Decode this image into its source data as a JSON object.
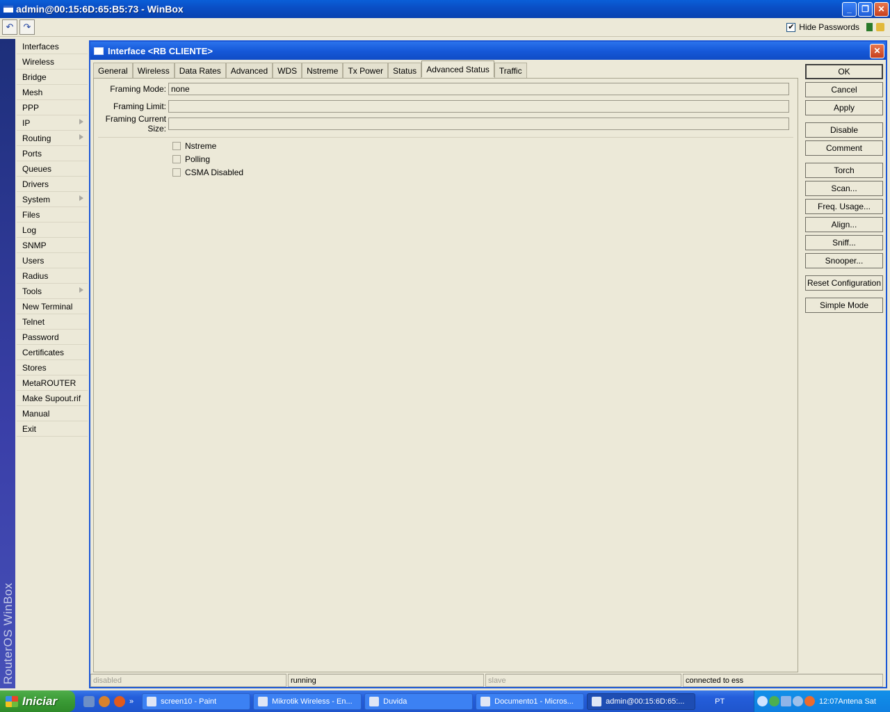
{
  "window": {
    "title": "admin@00:15:6D:65:B5:73 - WinBox"
  },
  "toolbar": {
    "undo_label": "↶",
    "redo_label": "↷",
    "hide_passwords_label": "Hide Passwords",
    "hide_passwords_checked": true,
    "check_mark": "✔"
  },
  "vband": {
    "label": "RouterOS WinBox"
  },
  "sidebar": {
    "items": [
      {
        "label": "Interfaces"
      },
      {
        "label": "Wireless"
      },
      {
        "label": "Bridge"
      },
      {
        "label": "Mesh"
      },
      {
        "label": "PPP"
      },
      {
        "label": "IP",
        "submenu": true
      },
      {
        "label": "Routing",
        "submenu": true
      },
      {
        "label": "Ports"
      },
      {
        "label": "Queues"
      },
      {
        "label": "Drivers"
      },
      {
        "label": "System",
        "submenu": true
      },
      {
        "label": "Files"
      },
      {
        "label": "Log"
      },
      {
        "label": "SNMP"
      },
      {
        "label": "Users"
      },
      {
        "label": "Radius"
      },
      {
        "label": "Tools",
        "submenu": true
      },
      {
        "label": "New Terminal"
      },
      {
        "label": "Telnet"
      },
      {
        "label": "Password"
      },
      {
        "label": "Certificates"
      },
      {
        "label": "Stores"
      },
      {
        "label": "MetaROUTER"
      },
      {
        "label": "Make Supout.rif"
      },
      {
        "label": "Manual"
      },
      {
        "label": "Exit"
      }
    ]
  },
  "dialog": {
    "title": "Interface <RB CLIENTE>",
    "tabs": [
      "General",
      "Wireless",
      "Data Rates",
      "Advanced",
      "WDS",
      "Nstreme",
      "Tx Power",
      "Status",
      "Advanced Status",
      "Traffic"
    ],
    "active_tab": "Advanced Status",
    "fields": [
      {
        "label": "Framing Mode:",
        "value": "none"
      },
      {
        "label": "Framing Limit:",
        "value": ""
      },
      {
        "label": "Framing Current Size:",
        "value": ""
      }
    ],
    "checkboxes": [
      {
        "label": "Nstreme",
        "checked": false
      },
      {
        "label": "Polling",
        "checked": false
      },
      {
        "label": "CSMA Disabled",
        "checked": false
      }
    ],
    "buttons": {
      "ok": "OK",
      "cancel": "Cancel",
      "apply": "Apply",
      "disable": "Disable",
      "comment": "Comment",
      "torch": "Torch",
      "scan": "Scan...",
      "freq_usage": "Freq. Usage...",
      "align": "Align...",
      "sniff": "Sniff...",
      "snooper": "Snooper...",
      "reset_configuration": "Reset Configuration",
      "simple_mode": "Simple Mode"
    },
    "status": {
      "enabled_state": "disabled",
      "run_state": "running",
      "slave_state": "slave",
      "connection": "connected to ess"
    }
  },
  "taskbar": {
    "start_label": "Iniciar",
    "tasks": [
      {
        "label": "screen10 - Paint"
      },
      {
        "label": "Mikrotik Wireless - En..."
      },
      {
        "label": "Duvida"
      },
      {
        "label": "Documento1 - Micros..."
      },
      {
        "label": "admin@00:15:6D:65:..."
      }
    ],
    "language": "PT",
    "clock": "12:07Antena Sat",
    "quicklaunch_more": "»"
  }
}
